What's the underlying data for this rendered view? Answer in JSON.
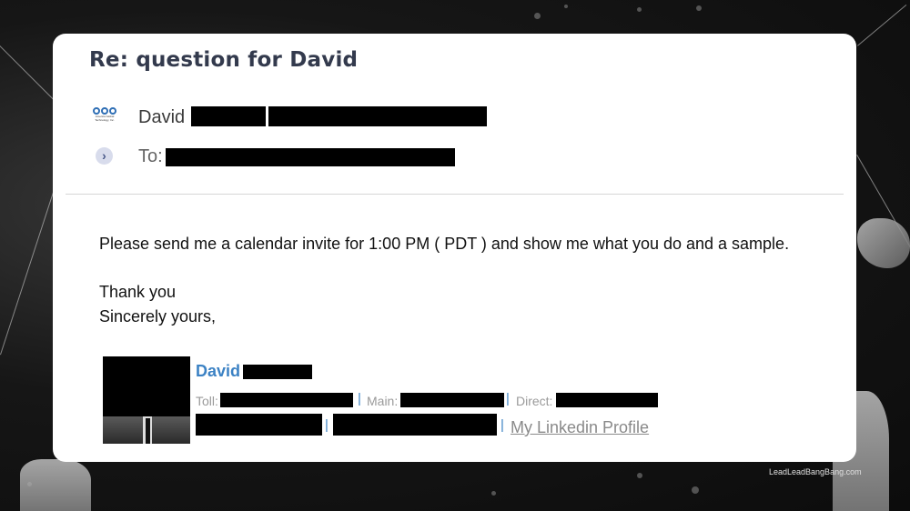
{
  "email": {
    "subject": "Re: question for David",
    "sender_logo_text": "America Global Technology, Inc.",
    "sender_name": "David",
    "to_label": "To:",
    "body": {
      "line1": "Please send me a calendar invite for 1:00 PM ( PDT ) and show me what you do and a sample.",
      "line2": "Thank you",
      "line3": "Sincerely yours,"
    },
    "signature": {
      "name": "David",
      "toll_label": "Toll:",
      "main_label": "Main:",
      "direct_label": "Direct:",
      "separator": "|",
      "linkedin_text": "My Linkedin Profile"
    }
  },
  "watermark": "LeadLeadBangBang.com",
  "colors": {
    "subject": "#333a4d",
    "signature_accent": "#3c82c4",
    "link": "#8a8a8a",
    "redaction": "#000000"
  },
  "icons": {
    "sender_logo": "company-logo-icon",
    "expand_recipients": "chevron-right-icon"
  }
}
